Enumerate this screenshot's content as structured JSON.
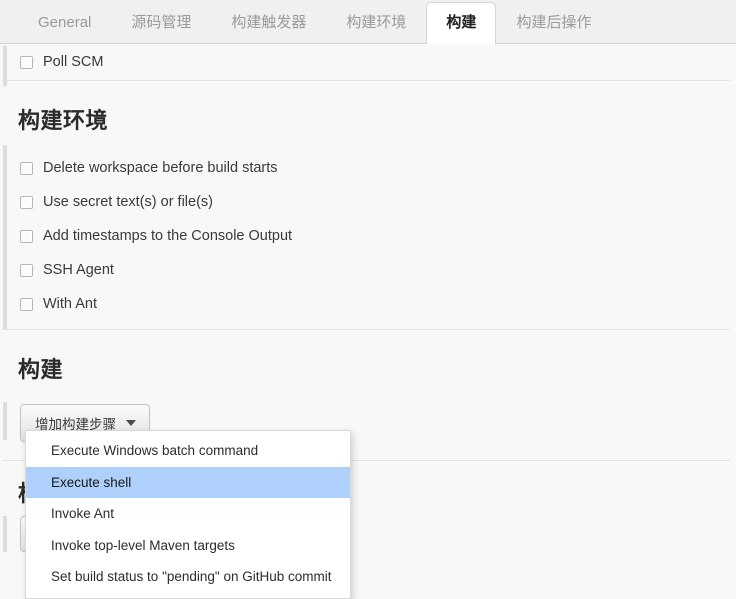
{
  "tabs": [
    {
      "label": "General",
      "active": false
    },
    {
      "label": "源码管理",
      "active": false
    },
    {
      "label": "构建触发器",
      "active": false
    },
    {
      "label": "构建环境",
      "active": false
    },
    {
      "label": "构建",
      "active": true
    },
    {
      "label": "构建后操作",
      "active": false
    }
  ],
  "trigger_section": {
    "poll_scm_label": "Poll SCM",
    "poll_scm_checked": false
  },
  "build_env_section": {
    "title": "构建环境",
    "options": [
      {
        "label": "Delete workspace before build starts",
        "checked": false
      },
      {
        "label": "Use secret text(s) or file(s)",
        "checked": false
      },
      {
        "label": "Add timestamps to the Console Output",
        "checked": false
      },
      {
        "label": "SSH Agent",
        "checked": false
      },
      {
        "label": "With Ant",
        "checked": false
      }
    ]
  },
  "build_section": {
    "title": "构建",
    "add_step_button": "增加构建步骤",
    "caret_icon": "chevron-down-icon"
  },
  "dropdown": {
    "items": [
      {
        "label": "Execute Windows batch command",
        "selected": false
      },
      {
        "label": "Execute shell",
        "selected": true
      },
      {
        "label": "Invoke Ant",
        "selected": false
      },
      {
        "label": "Invoke top-level Maven targets",
        "selected": false
      },
      {
        "label": "Set build status to \"pending\" on GitHub commit",
        "selected": false
      }
    ]
  },
  "post_build_section": {
    "title": "构"
  },
  "colors": {
    "highlight": "#aed0fb",
    "page_background": "#f8f8f8",
    "tabbar_background": "#f0f0f0",
    "active_tab_background": "#ffffff",
    "border": "#d5d5d5",
    "text": "#333333",
    "muted_text": "#9a9a9a"
  }
}
